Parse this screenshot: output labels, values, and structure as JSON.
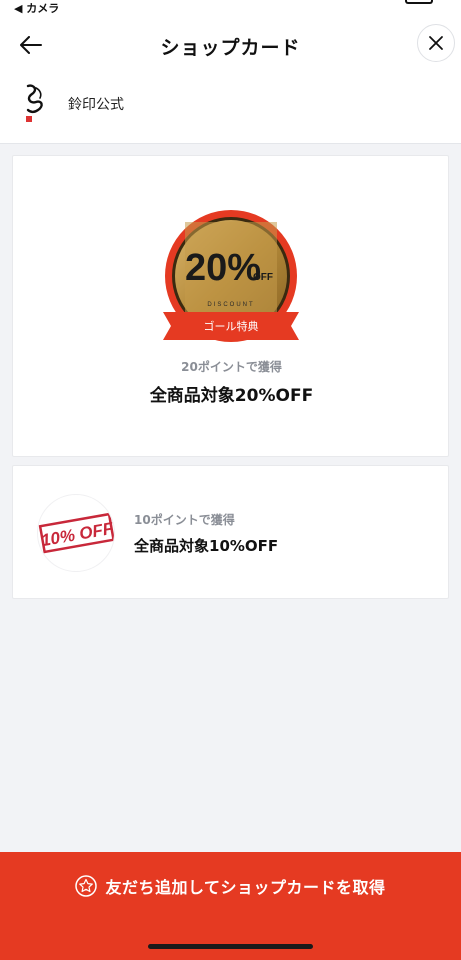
{
  "status_bar": {
    "back_label": "◀ カメラ"
  },
  "header": {
    "title": "ショップカード"
  },
  "shop": {
    "name": "鈴印公式"
  },
  "cards": [
    {
      "badge_percent": "20%",
      "badge_off": "OFF",
      "badge_sub": "DISCOUNT",
      "ribbon": "ゴール特典",
      "points": "20ポイントで獲得",
      "title": "全商品対象20%OFF"
    },
    {
      "stamp": "10% OFF",
      "points": "10ポイントで獲得",
      "title": "全商品対象10%OFF"
    }
  ],
  "cta": {
    "label": "友だち追加してショップカードを取得"
  },
  "colors": {
    "accent": "#e53a22",
    "gold": "#b48a3a",
    "background": "#f2f3f6"
  }
}
